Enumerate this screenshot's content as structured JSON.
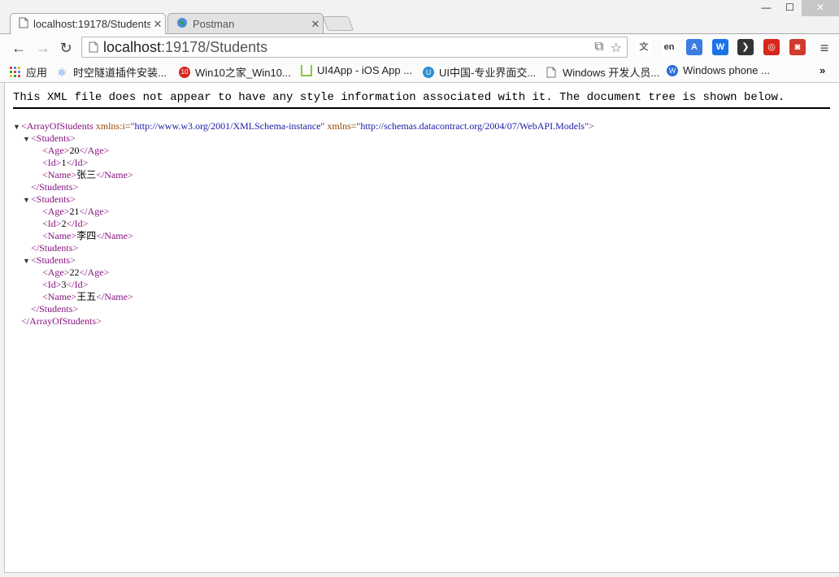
{
  "browser": {
    "tabs": [
      {
        "title": "localhost:19178/Students",
        "active": true
      },
      {
        "title": "Postman",
        "active": false
      }
    ],
    "window_buttons": {
      "minimize": "—",
      "maximize": "☐",
      "close": "✕"
    },
    "address": {
      "host": "localhost",
      "path": ":19178/Students"
    },
    "bookmarks": [
      {
        "label": "应用"
      },
      {
        "label": "时空隧道插件安装..."
      },
      {
        "label": "Win10之家_Win10..."
      },
      {
        "label": "UI4App - iOS App ..."
      },
      {
        "label": "UI中国-专业界面交..."
      },
      {
        "label": "Windows 开发人员..."
      },
      {
        "label": "Windows phone ..."
      }
    ],
    "bookmarks_more": "»",
    "extensions": [
      {
        "icon": "translate-icon",
        "color": "#777777"
      },
      {
        "icon": "en-translate-icon",
        "color": "#444444"
      },
      {
        "icon": "google-translate-icon",
        "color": "#3b7de0"
      },
      {
        "icon": "w-extension-icon",
        "color": "#1a73e8"
      },
      {
        "icon": "evernote-icon",
        "color": "#333333"
      },
      {
        "icon": "netease-icon",
        "color": "#d8261c"
      },
      {
        "icon": "red-extension-icon",
        "color": "#d03a2f"
      }
    ]
  },
  "page": {
    "notice": "This XML file does not appear to have any style information associated with it. The document tree is shown below.",
    "root": {
      "open": "<ArrayOfStudents",
      "attr1_name": " xmlns:i=",
      "attr1_value": "\"http://www.w3.org/2001/XMLSchema-instance\"",
      "attr2_name": " xmlns=",
      "attr2_value": "\"http://schemas.datacontract.org/2004/07/WebAPI.Models\"",
      "open_end": ">",
      "close": "</ArrayOfStudents>"
    },
    "students_open": "<Students>",
    "students_close": "</Students>",
    "tags": {
      "age_open": "<Age>",
      "age_close": "</Age>",
      "id_open": "<Id>",
      "id_close": "</Id>",
      "name_open": "<Name>",
      "name_close": "</Name>"
    },
    "students": [
      {
        "age": "20",
        "id": "1",
        "name": "张三"
      },
      {
        "age": "21",
        "id": "2",
        "name": "李四"
      },
      {
        "age": "22",
        "id": "3",
        "name": "王五"
      }
    ]
  }
}
